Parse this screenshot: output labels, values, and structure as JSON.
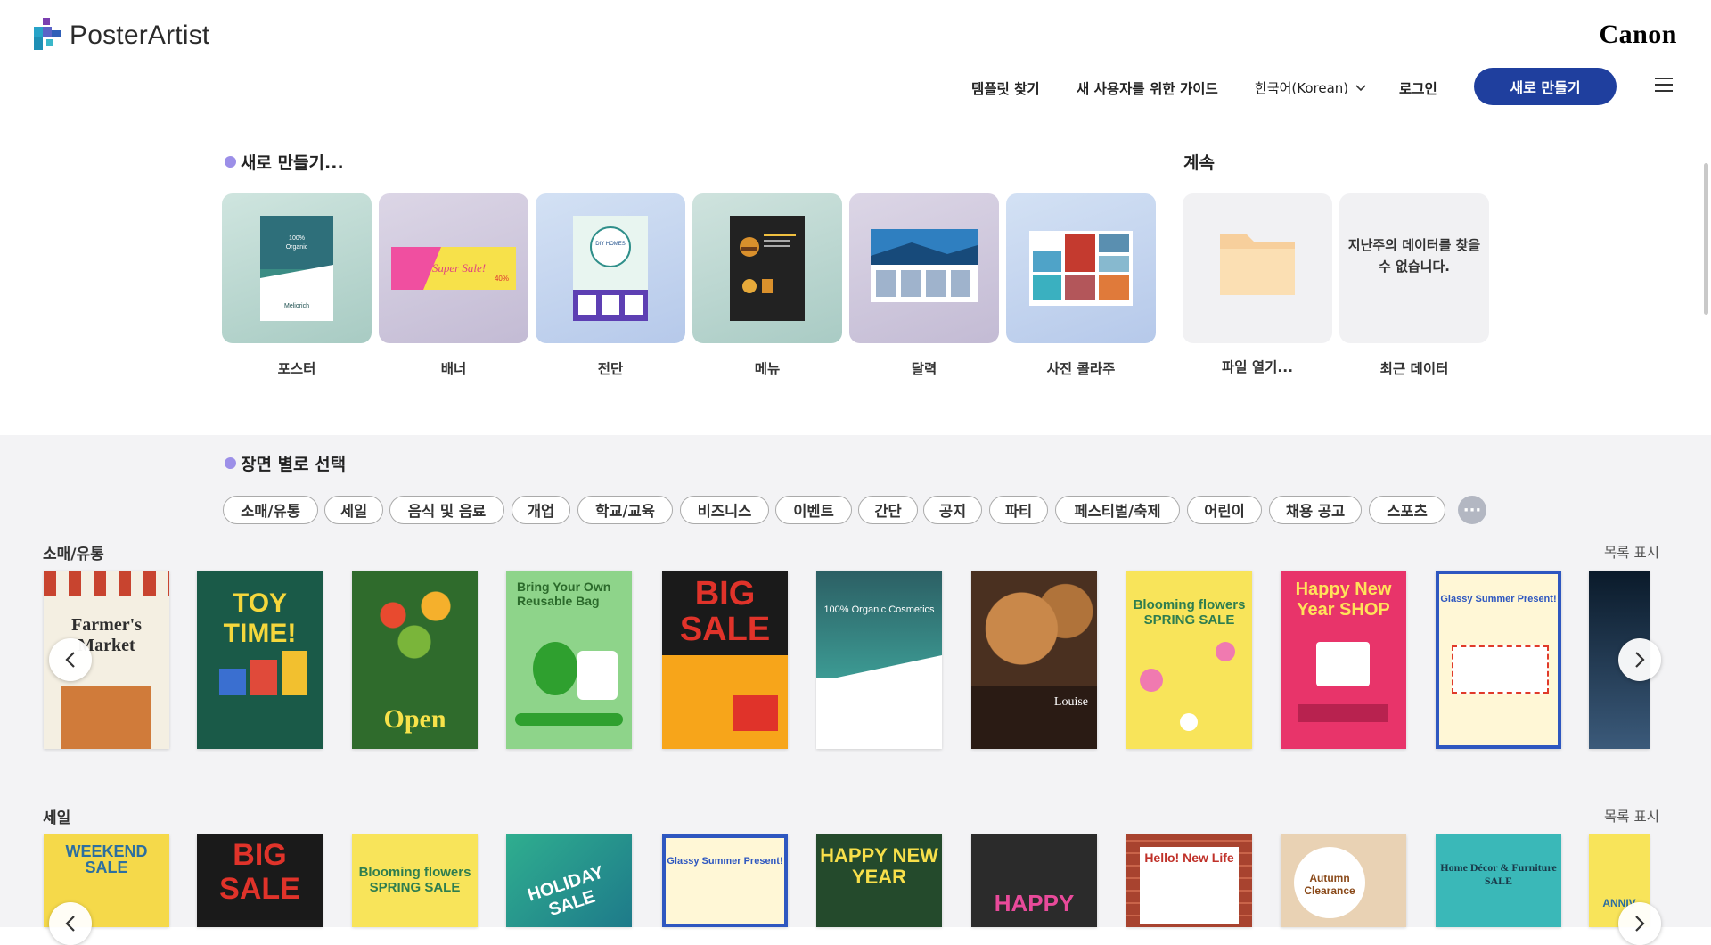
{
  "app": {
    "logo_text": "PosterArtist",
    "brand": "Canon"
  },
  "nav": {
    "items": [
      "템플릿 찾기",
      "새 사용자를 위한 가이드"
    ],
    "language": "한국어(Korean)",
    "login": "로그인",
    "new_button": "새로 만들기"
  },
  "create": {
    "title": "새로 만들기...",
    "cards": [
      {
        "label": "포스터"
      },
      {
        "label": "배너"
      },
      {
        "label": "전단"
      },
      {
        "label": "메뉴"
      },
      {
        "label": "달력"
      },
      {
        "label": "사진 콜라주"
      }
    ]
  },
  "continue": {
    "title": "계속",
    "open_file": "파일 열기...",
    "no_data": "지난주의 데이터를 찾을 수 없습니다.",
    "recent": "최근 데이터"
  },
  "scenes": {
    "title": "장면 별로 선택",
    "chips": [
      "소매/유통",
      "세일",
      "음식 및 음료",
      "개업",
      "학교/교육",
      "비즈니스",
      "이벤트",
      "간단",
      "공지",
      "파티",
      "페스티벌/축제",
      "어린이",
      "채용 공고",
      "스포츠"
    ],
    "more": "···"
  },
  "rows": [
    {
      "label": "소매/유통",
      "link": "목록 표시",
      "thumbs": [
        {
          "text": "Farmer's Market"
        },
        {
          "text": "TOY TIME!"
        },
        {
          "text": "Open"
        },
        {
          "text": "Bring Your Own Reusable Bag"
        },
        {
          "text": "BIG SALE"
        },
        {
          "text": "100% Organic Cosmetics"
        },
        {
          "text": "Louise"
        },
        {
          "text": "Blooming flowers SPRING SALE"
        },
        {
          "text": "Happy New Year SHOP"
        },
        {
          "text": "Glassy Summer Present!"
        },
        {
          "text": ""
        }
      ]
    },
    {
      "label": "세일",
      "link": "목록 표시",
      "thumbs": [
        {
          "text": "WEEKEND SALE"
        },
        {
          "text": "BIG SALE"
        },
        {
          "text": "Blooming flowers SPRING SALE"
        },
        {
          "text": "HOLIDAY SALE"
        },
        {
          "text": "Glassy Summer Present!"
        },
        {
          "text": "HAPPY NEW YEAR"
        },
        {
          "text": "HAPPY"
        },
        {
          "text": "Hello! New Life"
        },
        {
          "text": "Autumn Clearance"
        },
        {
          "text": "Home Décor & Furniture SALE"
        },
        {
          "text": "ANNIV"
        }
      ]
    }
  ],
  "colors": {
    "accent": "#1f3f9e",
    "dot": "#9c8fe8",
    "scene_bg": "#f3f3f5"
  }
}
